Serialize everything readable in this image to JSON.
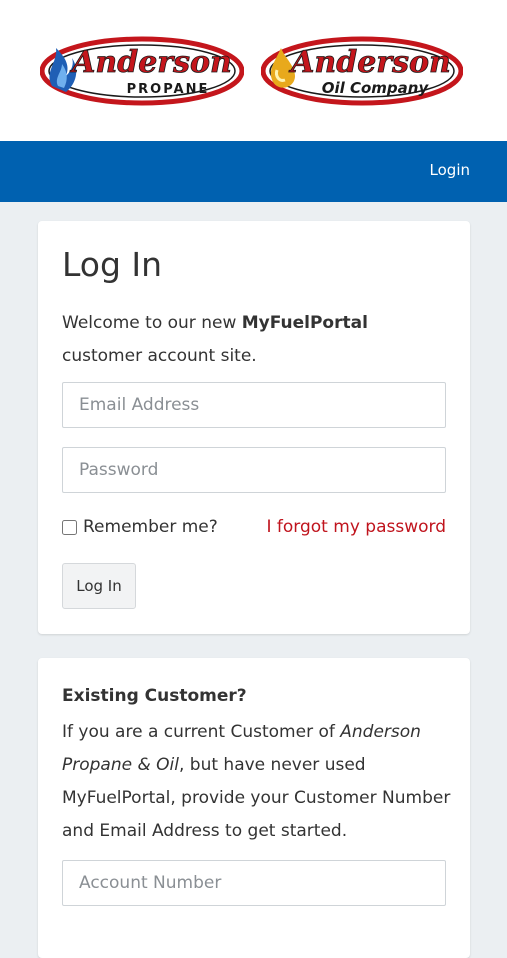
{
  "header": {
    "logo_left": {
      "main": "Anderson",
      "sub": "PROPANE"
    },
    "logo_right": {
      "main": "Anderson",
      "sub": "Oil Company"
    }
  },
  "nav": {
    "login_link": "Login"
  },
  "login_card": {
    "title": "Log In",
    "welcome_prefix": "Welcome to our new ",
    "welcome_brand": "MyFuelPortal",
    "welcome_suffix": " customer account site.",
    "email_placeholder": "Email Address",
    "password_placeholder": "Password",
    "remember_label": "Remember me?",
    "forgot_link": "I forgot my password",
    "submit_label": "Log In"
  },
  "existing_card": {
    "heading": "Existing Customer?",
    "body_prefix": "If you are a current Customer of ",
    "body_company": "Anderson Propane & Oil",
    "body_suffix": ", but have never used MyFuelPortal, provide your Customer Number and Email Address to get started.",
    "account_placeholder": "Account Number"
  },
  "colors": {
    "nav_blue": "#0061b0",
    "link_red": "#c0141d",
    "page_bg": "#ebeff2"
  }
}
